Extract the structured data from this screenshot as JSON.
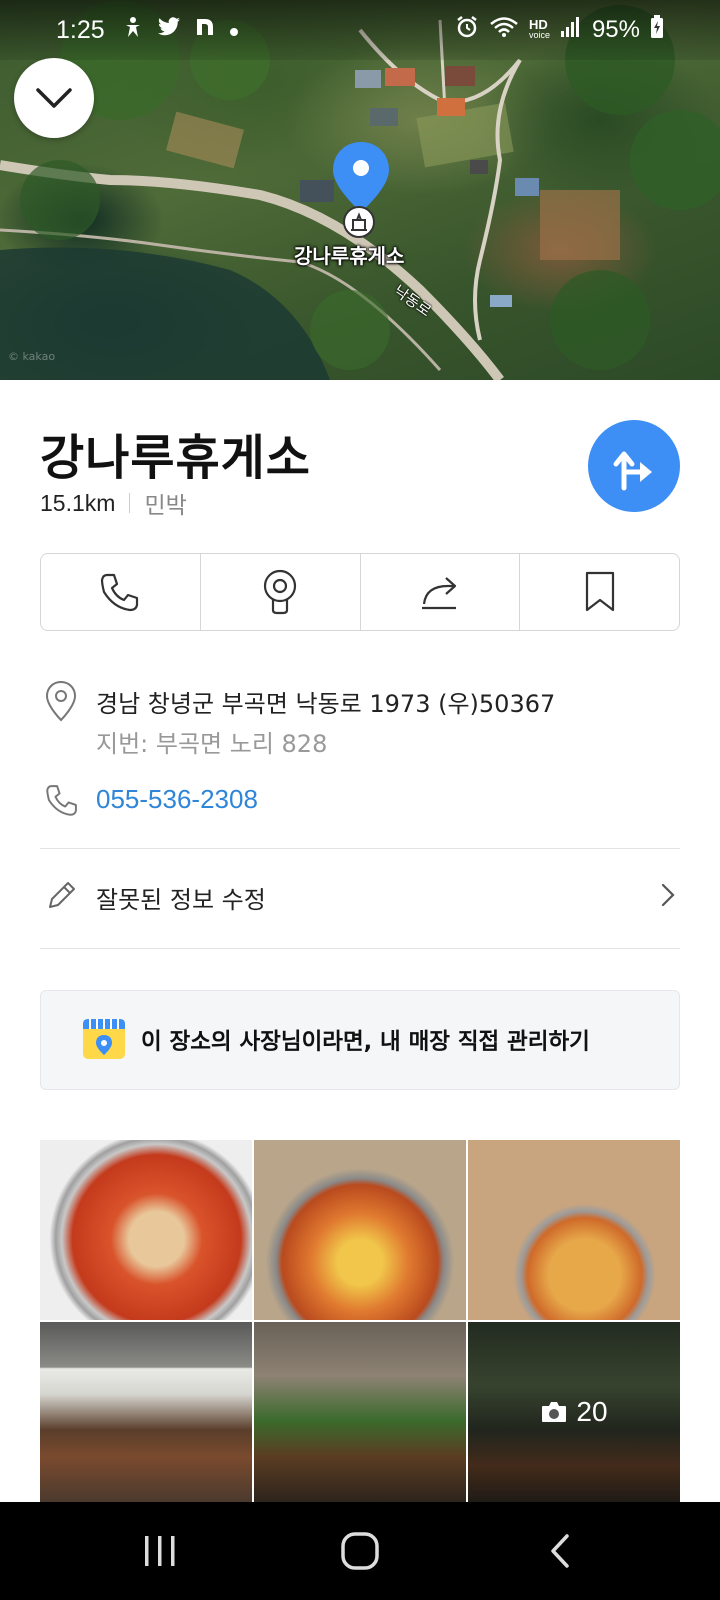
{
  "status_bar": {
    "time": "1:25",
    "notification_icons": [
      "accessibility-icon",
      "twitter-icon",
      "naver-icon",
      "dot-icon"
    ],
    "indicator_icons": [
      "alarm-icon",
      "wifi-icon",
      "hd-voice-icon",
      "signal-icon",
      "battery-icon"
    ],
    "hd_label": "HD",
    "voice_label": "voice",
    "battery": "95%"
  },
  "map": {
    "place_label": "강나루휴게소",
    "road_label": "낙동로",
    "watermark": "© kakao"
  },
  "place": {
    "name": "강나루휴게소",
    "distance": "15.1km",
    "category": "민박"
  },
  "actions": [
    {
      "name": "call",
      "icon": "phone-icon"
    },
    {
      "name": "roadview",
      "icon": "roadview-icon"
    },
    {
      "name": "share",
      "icon": "share-icon"
    },
    {
      "name": "save",
      "icon": "bookmark-icon"
    }
  ],
  "info": {
    "address": "경남 창녕군 부곡면 낙동로 1973 (우)50367",
    "jibun": "지번: 부곡면 노리 828",
    "phone": "055-536-2308"
  },
  "edit": {
    "label": "잘못된 정보 수정"
  },
  "owner_banner": {
    "text": "이 장소의 사장님이라면, 내 매장 직접 관리하기"
  },
  "photos": {
    "more_count": "20"
  },
  "colors": {
    "accent": "#3d8ff5",
    "phone_link": "#2f86d8",
    "banner_bg": "#f5f6f8"
  }
}
